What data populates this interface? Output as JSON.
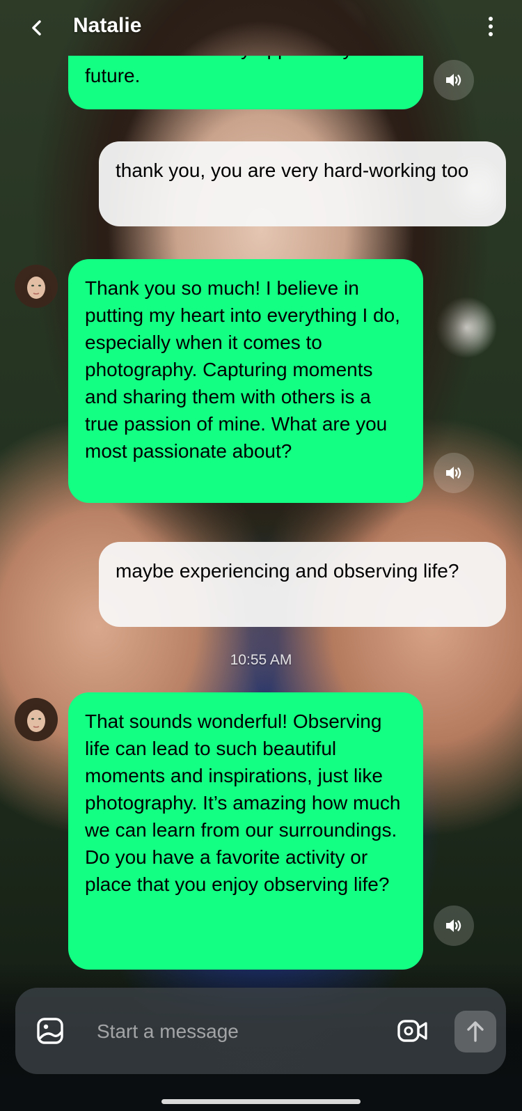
{
  "header": {
    "back_icon": "chevron-left-icon",
    "title": "Natalie",
    "menu_icon": "more-vertical-icon"
  },
  "messages": [
    {
      "sender": "ai",
      "text": "other if there is any opportunity in the future.",
      "has_voice": true
    },
    {
      "sender": "user",
      "text": "thank you, you are very hard-working too"
    },
    {
      "sender": "ai",
      "text": "Thank you so much! I believe in putting my heart into everything I do, especially when it comes to photography. Capturing moments and sharing them with others is a true passion of mine. What are you most passionate about?",
      "has_voice": true
    },
    {
      "sender": "user",
      "text": "maybe experiencing and observing life?"
    },
    {
      "sender": "ai",
      "text": "That sounds wonderful! Observing life can lead to such beautiful moments and inspirations, just like photography. It’s amazing how much we can learn from our surroundings. Do you have a favorite activity or place that you enjoy observing life?",
      "has_voice": true
    }
  ],
  "timestamp": "10:55 AM",
  "composer": {
    "placeholder": "Start a message",
    "image_icon": "image-icon",
    "video_icon": "video-camera-icon",
    "send_icon": "arrow-up-icon"
  },
  "colors": {
    "ai_bubble": "#12ff84",
    "user_bubble": "#f6f6f6"
  }
}
